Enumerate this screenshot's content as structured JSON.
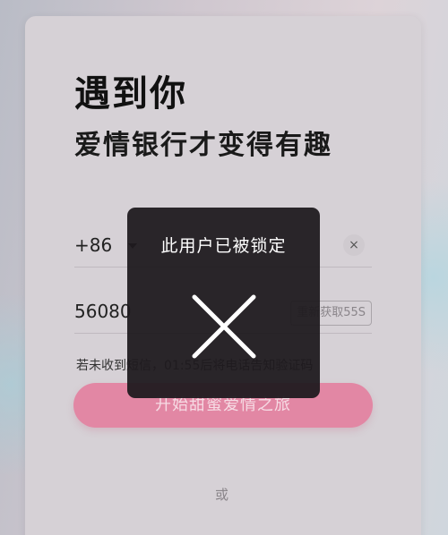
{
  "login": {
    "headline": "遇到你",
    "subheadline": "爱情银行才变得有趣",
    "phone": {
      "country_code": "+86",
      "clear_icon_glyph": "×",
      "clear_icon": "clear-icon"
    },
    "verification": {
      "code_value": "56080",
      "resend_label": "重新获取55S"
    },
    "hint": "若未收到短信，01:55后将电话告知验证码",
    "start_button_label": "开始甜蜜爱情之旅",
    "or_text": "或",
    "accent_color": "#e287a4"
  },
  "toast": {
    "message": "此用户已被锁定",
    "icon": "close-x-icon"
  }
}
